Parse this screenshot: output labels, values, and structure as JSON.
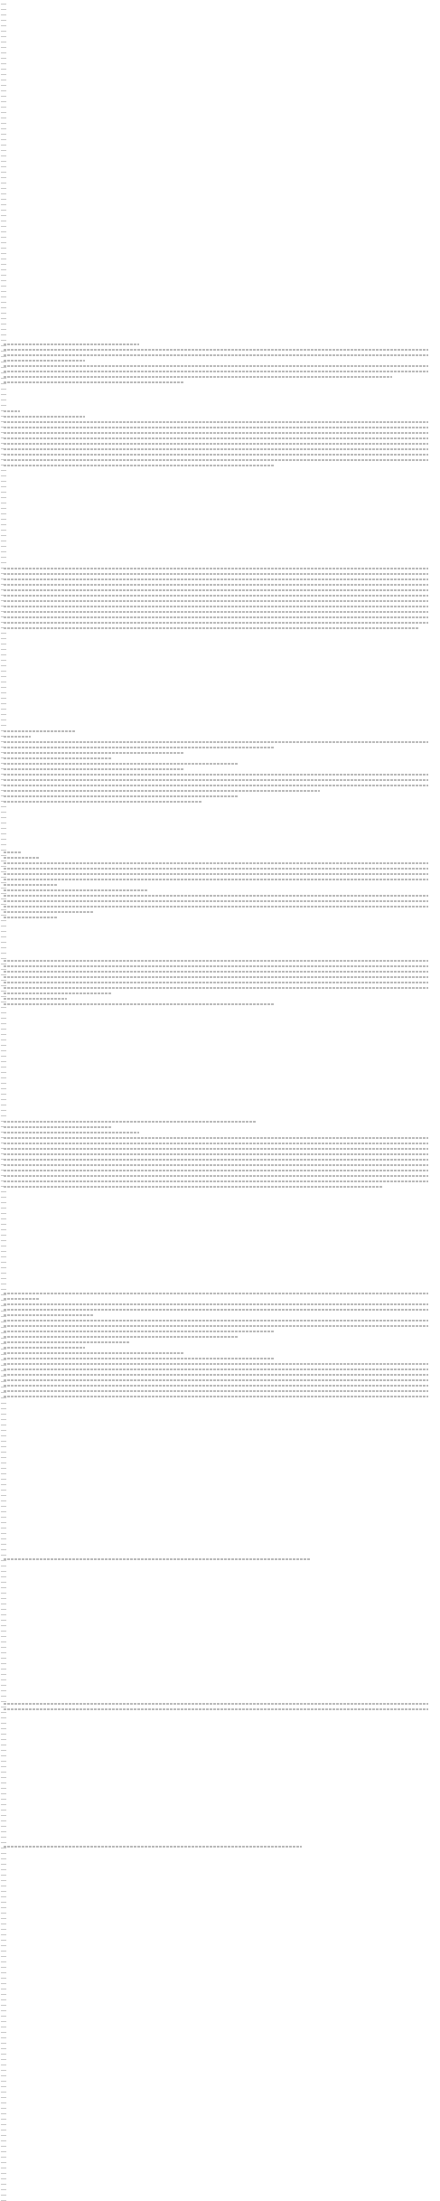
{
  "document": {
    "paragraphs": [
      {
        "id": "p1",
        "lines": []
      },
      {
        "id": "p2",
        "lines": []
      },
      {
        "id": "p3",
        "lines": []
      },
      {
        "id": "p4",
        "lines": []
      },
      {
        "id": "p5",
        "lines": []
      },
      {
        "id": "p6",
        "lines": []
      },
      {
        "id": "p7",
        "lines": []
      },
      {
        "id": "p8",
        "lines": []
      },
      {
        "id": "p9",
        "lines": []
      }
    ]
  }
}
